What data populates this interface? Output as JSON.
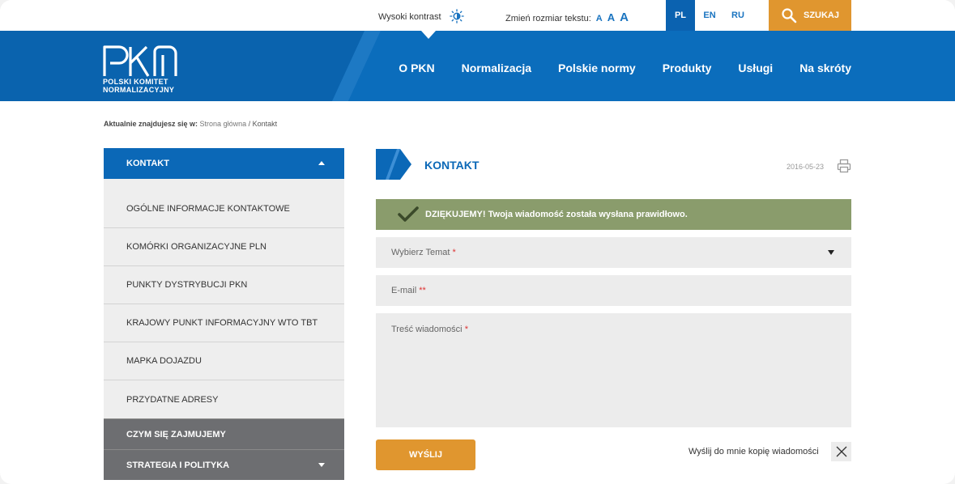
{
  "topbar": {
    "contrast_label": "Wysoki kontrast",
    "contrast_icon": "contrast-sun-icon",
    "textsize_label": "Zmień rozmiar tekstu:",
    "textsize_options": [
      "A",
      "A",
      "A"
    ],
    "languages": [
      {
        "code": "PL",
        "active": true
      },
      {
        "code": "EN",
        "active": false
      },
      {
        "code": "RU",
        "active": false
      }
    ],
    "search_label": "SZUKAJ",
    "search_icon": "search-icon"
  },
  "header": {
    "logo_text": "PKN",
    "logo_sub_line1": "POLSKI KOMITET",
    "logo_sub_line2": "NORMALIZACYJNY",
    "nav": [
      "O PKN",
      "Normalizacja",
      "Polskie normy",
      "Produkty",
      "Usługi",
      "Na skróty"
    ],
    "colors": {
      "primary": "#0b68b7",
      "accent": "#e0962f"
    }
  },
  "breadcrumb": {
    "prefix": "Aktualnie znajdujesz się w:",
    "home": "Strona główna",
    "separator": "/",
    "current": "Kontakt"
  },
  "sidebar": {
    "section_title": "KONTAKT",
    "items": [
      "OGÓLNE INFORMACJE KONTAKTOWE",
      "KOMÓRKI ORGANIZACYJNE PLN",
      "PUNKTY DYSTRYBUCJI PKN",
      "KRAJOWY PUNKT INFORMACYJNY WTO TBT",
      "MAPKA DOJAZDU",
      "PRZYDATNE ADRESY"
    ],
    "other_sections": [
      "CZYM SIĘ ZAJMUJEMY",
      "STRATEGIA I POLITYKA"
    ]
  },
  "main": {
    "title": "KONTAKT",
    "date": "2016-05-23",
    "print_icon": "print-icon",
    "success_message": "DZIĘKUJEMY! Twoja wiadomość została wysłana prawidłowo.",
    "form": {
      "topic_placeholder": "Wybierz Temat",
      "topic_required": "*",
      "email_placeholder": "E-mail",
      "email_required": "**",
      "message_placeholder": "Treść wiadomości",
      "message_required": "*",
      "submit_label": "WYŚLIJ",
      "copy_label": "Wyślij do mnie kopię wiadomości"
    }
  }
}
